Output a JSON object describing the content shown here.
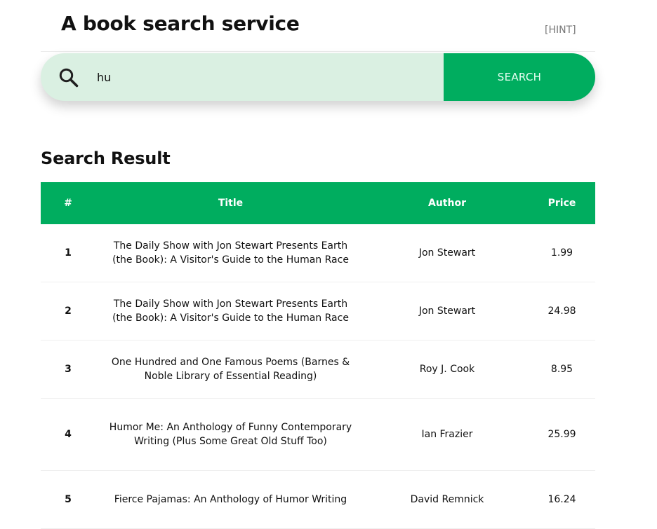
{
  "header": {
    "title": "A book search service",
    "hint_label": "[HINT]"
  },
  "search": {
    "value": "hu",
    "button_label": "SEARCH",
    "icon": "search-icon"
  },
  "results": {
    "heading": "Search Result",
    "columns": [
      "#",
      "Title",
      "Author",
      "Price"
    ],
    "rows": [
      {
        "index": "1",
        "title": "The Daily Show with Jon Stewart Presents Earth (the Book): A Visitor's Guide to the Human Race",
        "author": "Jon Stewart",
        "price": "1.99"
      },
      {
        "index": "2",
        "title": "The Daily Show with Jon Stewart Presents Earth (the Book): A Visitor's Guide to the Human Race",
        "author": "Jon Stewart",
        "price": "24.98"
      },
      {
        "index": "3",
        "title": "One Hundred and One Famous Poems (Barnes & Noble Library of Essential Reading)",
        "author": "Roy J. Cook",
        "price": "8.95"
      },
      {
        "index": "4",
        "title": "Humor Me: An Anthology of Funny Contemporary Writing (Plus Some Great Old Stuff Too)",
        "author": "Ian Frazier",
        "price": "25.99"
      },
      {
        "index": "5",
        "title": "Fierce Pajamas: An Anthology of Humor Writing",
        "author": "David Remnick",
        "price": "16.24"
      }
    ]
  },
  "colors": {
    "accent": "#00ad5f",
    "search_background": "#daf0e2"
  }
}
